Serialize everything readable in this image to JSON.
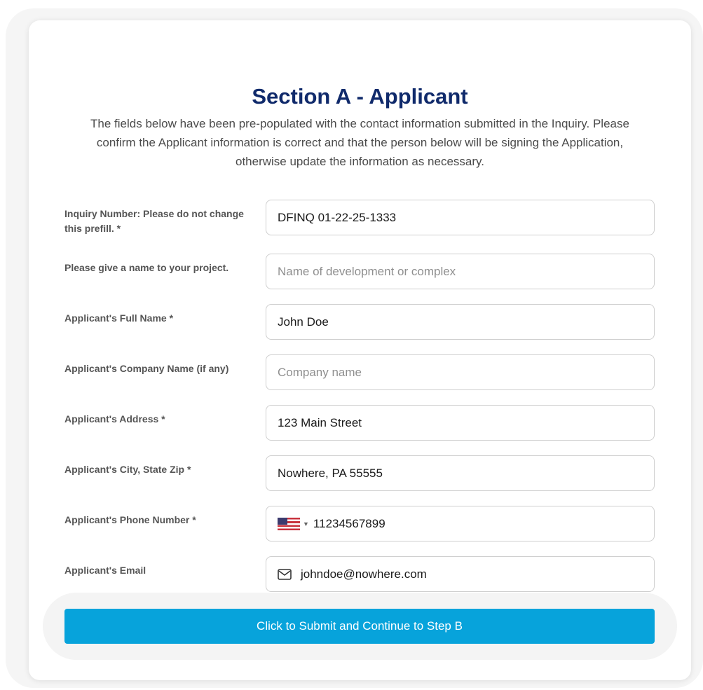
{
  "section": {
    "title": "Section A - Applicant",
    "intro": "The fields below have been pre-populated with the contact information submitted in the Inquiry. Please confirm the Applicant information is correct and that the person below will be signing the Application, otherwise update the information as necessary."
  },
  "fields": {
    "inquiry": {
      "label": "Inquiry Number: Please do not change this prefill. *",
      "value": "DFINQ 01-22-25-1333"
    },
    "project": {
      "label": "Please give a name to your project.",
      "value": "",
      "placeholder": "Name of development or complex"
    },
    "full_name": {
      "label": "Applicant's Full Name *",
      "value": "John Doe"
    },
    "company": {
      "label": "Applicant's Company Name (if any)",
      "value": "",
      "placeholder": "Company name"
    },
    "address": {
      "label": "Applicant's Address *",
      "value": "123 Main Street"
    },
    "city": {
      "label": "Applicant's City, State Zip *",
      "value": "Nowhere, PA 55555"
    },
    "phone": {
      "label": "Applicant's Phone Number *",
      "value": "11234567899",
      "country_icon": "us-flag-icon"
    },
    "email": {
      "label": "Applicant's Email",
      "value": "johndoe@nowhere.com",
      "icon": "mail-icon"
    }
  },
  "submit": {
    "label": "Click to Submit and Continue to Step B"
  },
  "colors": {
    "title": "#102a6b",
    "accent": "#07a3db",
    "label": "#555555",
    "border": "#cfcfcf"
  }
}
